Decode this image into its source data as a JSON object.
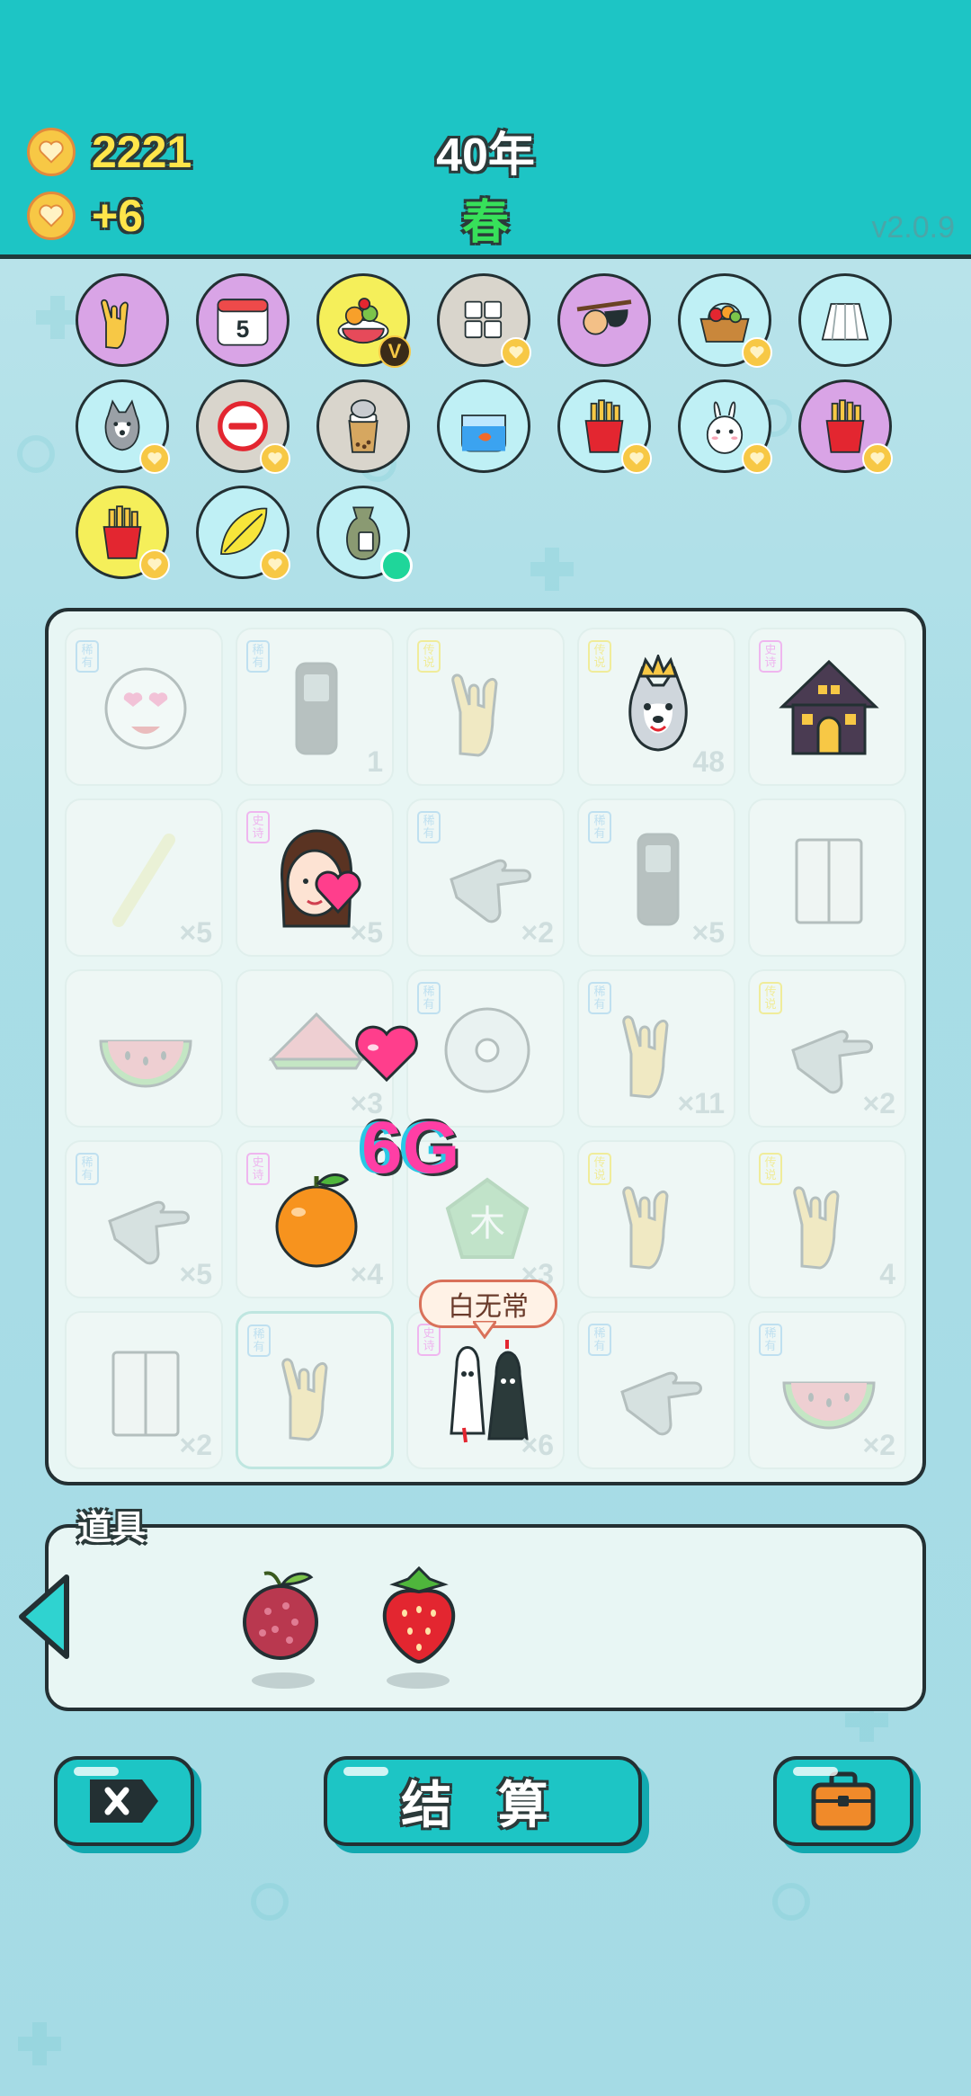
{
  "header": {
    "coins": "2221",
    "income": "+6",
    "year": "40年",
    "season": "春",
    "version": "v2.0.9"
  },
  "colors": {
    "topbar": "#1dc5c5",
    "coin": "#f7c845",
    "season": "#37e05a",
    "accent_pink": "#ff3ea5"
  },
  "collection": [
    {
      "icon": "rock-hand-icon",
      "bg": "#d9a4e6",
      "badge": "none"
    },
    {
      "icon": "calendar-icon",
      "bg": "#d9a4e6",
      "badge": "none",
      "text": "5"
    },
    {
      "icon": "fruit-platter-icon",
      "bg": "#f5ef5a",
      "badge": "v",
      "badge_text": "V"
    },
    {
      "icon": "sugar-cubes-icon",
      "bg": "#d9d5cc",
      "badge": "heart"
    },
    {
      "icon": "eyepatch-icon",
      "bg": "#d9a4e6",
      "badge": "none"
    },
    {
      "icon": "fruit-basket-icon",
      "bg": "#bff0f5",
      "badge": "heart"
    },
    {
      "icon": "skirt-icon",
      "bg": "#bff0f5",
      "badge": "none"
    },
    {
      "icon": "husky-icon",
      "bg": "#bff0f5",
      "badge": "heart"
    },
    {
      "icon": "no-entry-icon",
      "bg": "#d9d5cc",
      "badge": "heart"
    },
    {
      "icon": "milk-tea-icon",
      "bg": "#d9d5cc",
      "badge": "none"
    },
    {
      "icon": "fish-tank-icon",
      "bg": "#bff0f5",
      "badge": "none"
    },
    {
      "icon": "fries-icon",
      "bg": "#bff0f5",
      "badge": "heart"
    },
    {
      "icon": "rabbit-icon",
      "bg": "#bff0f5",
      "badge": "heart"
    },
    {
      "icon": "fries-icon",
      "bg": "#d9a4e6",
      "badge": "heart"
    },
    {
      "icon": "fries-icon",
      "bg": "#f5ef5a",
      "badge": "heart"
    },
    {
      "icon": "leaf-icon",
      "bg": "#bff0f5",
      "badge": "heart"
    },
    {
      "icon": "sack-icon",
      "bg": "#bff0f5",
      "badge": "dot"
    }
  ],
  "grid": [
    {
      "tag": "稀有",
      "icon": "heart-eyes-face-icon",
      "count": "",
      "faded": true
    },
    {
      "tag": "稀有",
      "icon": "phone-icon",
      "count": "1",
      "faded": true
    },
    {
      "tag": "传说",
      "icon": "rock-hand-icon",
      "count": "",
      "faded": true
    },
    {
      "tag": "传说",
      "icon": "husky-king-icon",
      "count": "48",
      "faded": false
    },
    {
      "tag": "史诗",
      "icon": "haunted-house-icon",
      "count": "",
      "faded": false
    },
    {
      "tag": "",
      "icon": "stick-icon",
      "count": "×5",
      "faded": true
    },
    {
      "tag": "史诗",
      "icon": "girl-heart-icon",
      "count": "×5",
      "faded": false
    },
    {
      "tag": "稀有",
      "icon": "pointing-hand-icon",
      "count": "×2",
      "faded": true
    },
    {
      "tag": "稀有",
      "icon": "phone-icon",
      "count": "×5",
      "faded": true
    },
    {
      "tag": "",
      "icon": "book-icon",
      "count": "",
      "faded": true
    },
    {
      "tag": "",
      "icon": "watermelon-icon",
      "count": "",
      "faded": true
    },
    {
      "tag": "",
      "icon": "watermelon-heart-icon",
      "count": "×3",
      "faded": true
    },
    {
      "tag": "稀有",
      "icon": "cd-icon",
      "count": "",
      "faded": true
    },
    {
      "tag": "稀有",
      "icon": "rock-hand-icon",
      "count": "×11",
      "faded": true
    },
    {
      "tag": "传说",
      "icon": "pointing-hand-icon",
      "count": "×2",
      "faded": true
    },
    {
      "tag": "稀有",
      "icon": "pointing-hand-icon",
      "count": "×5",
      "faded": true
    },
    {
      "tag": "史诗",
      "icon": "orange-icon",
      "count": "×4",
      "faded": false
    },
    {
      "tag": "",
      "icon": "wood-pentagon-icon",
      "count": "×3",
      "faded": true
    },
    {
      "tag": "传说",
      "icon": "rock-hand-icon",
      "count": "",
      "faded": true
    },
    {
      "tag": "传说",
      "icon": "rock-hand-icon",
      "count": "4",
      "faded": true
    },
    {
      "tag": "",
      "icon": "book-icon",
      "count": "×2",
      "faded": true
    },
    {
      "tag": "稀有",
      "icon": "rock-hand-icon",
      "count": "",
      "faded": true
    },
    {
      "tag": "史诗",
      "icon": "ghost-pair-icon",
      "count": "×6",
      "faded": false
    },
    {
      "tag": "稀有",
      "icon": "pointing-hand-icon",
      "count": "",
      "faded": true
    },
    {
      "tag": "稀有",
      "icon": "watermelon-icon",
      "count": "×2",
      "faded": true
    }
  ],
  "floating": {
    "label": "6G",
    "tooltip": "白无常",
    "pentagon_char": "木"
  },
  "props": {
    "title": "道具",
    "items": [
      {
        "icon": "bayberry-icon"
      },
      {
        "icon": "strawberry-icon"
      }
    ]
  },
  "buttons": {
    "settle": "结 算"
  }
}
